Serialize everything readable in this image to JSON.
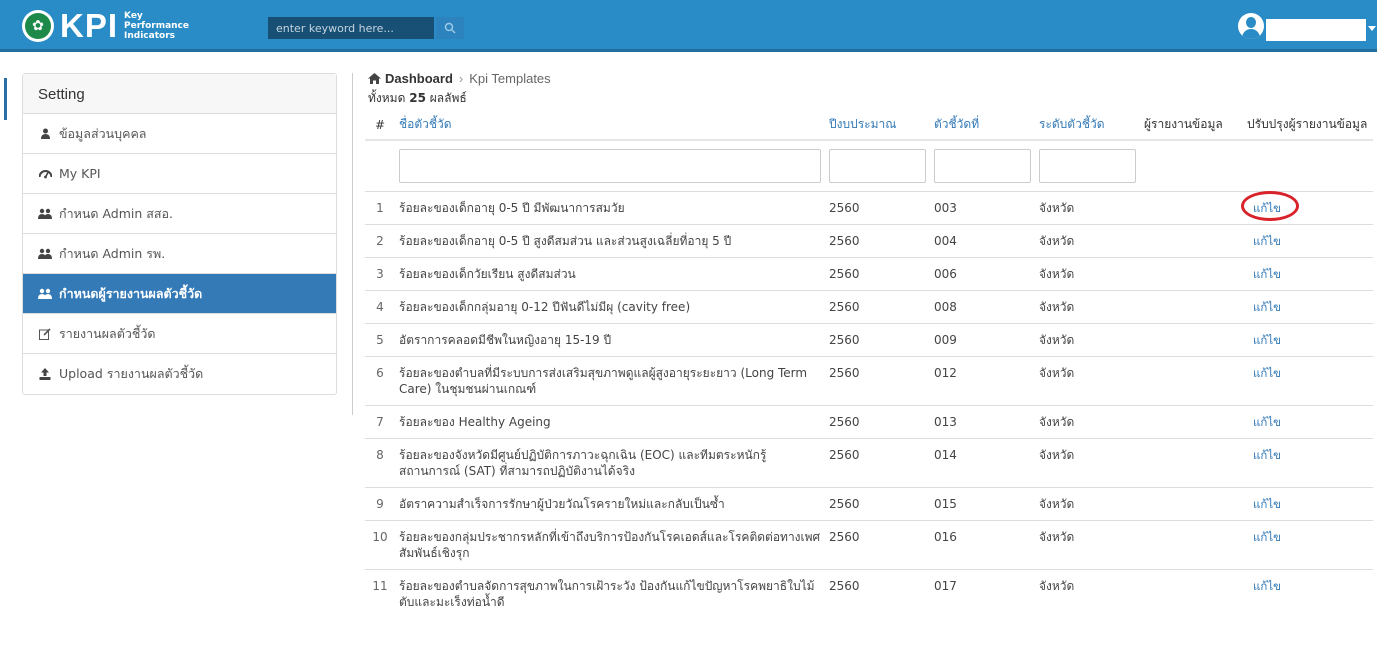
{
  "header": {
    "logo_text": "KPI",
    "logo_subtitle": "Key Performance Indicators",
    "search_placeholder": "enter keyword here..."
  },
  "sidebar": {
    "title": "Setting",
    "items": [
      {
        "label": "ข้อมูลส่วนบุคคล",
        "icon": "user-icon"
      },
      {
        "label": "My KPI",
        "icon": "dashboard-icon"
      },
      {
        "label": "กำหนด Admin สสอ.",
        "icon": "users-icon"
      },
      {
        "label": "กำหนด Admin รพ.",
        "icon": "users-icon"
      },
      {
        "label": "กำหนดผู้รายงานผลตัวชี้วัด",
        "icon": "users-icon",
        "active": true
      },
      {
        "label": "รายงานผลตัวชี้วัด",
        "icon": "edit-icon"
      },
      {
        "label": "Upload รายงานผลตัวชี้วัด",
        "icon": "upload-icon"
      }
    ]
  },
  "breadcrumb": {
    "home": "Dashboard",
    "separator": "›",
    "current": "Kpi Templates"
  },
  "summary": {
    "prefix": "ทั้งหมด",
    "count": "25",
    "suffix": "ผลลัพธ์"
  },
  "table": {
    "headers": {
      "num": "#",
      "name": "ชื่อตัวชี้วัด",
      "year": "ปีงบประมาณ",
      "code": "ตัวชี้วัดที่",
      "level": "ระดับตัวชี้วัด",
      "reporter": "ผู้รายงานข้อมูล",
      "update": "ปรับปรุงผู้รายงานข้อมูล"
    },
    "rows": [
      {
        "num": "1",
        "name": "ร้อยละของเด็กอายุ 0-5 ปี มีพัฒนาการสมวัย",
        "year": "2560",
        "code": "003",
        "level": "จังหวัด",
        "action": "แก้ไข",
        "highlighted": true
      },
      {
        "num": "2",
        "name": "ร้อยละของเด็กอายุ 0-5 ปี สูงดีสมส่วน และส่วนสูงเฉลี่ยที่อายุ 5 ปี",
        "year": "2560",
        "code": "004",
        "level": "จังหวัด",
        "action": "แก้ไข"
      },
      {
        "num": "3",
        "name": "ร้อยละของเด็กวัยเรียน สูงดีสมส่วน",
        "year": "2560",
        "code": "006",
        "level": "จังหวัด",
        "action": "แก้ไข"
      },
      {
        "num": "4",
        "name": "ร้อยละของเด็กกลุ่มอายุ 0-12 ปีฟันดีไม่มีผุ (cavity free)",
        "year": "2560",
        "code": "008",
        "level": "จังหวัด",
        "action": "แก้ไข"
      },
      {
        "num": "5",
        "name": "อัตราการคลอดมีชีพในหญิงอายุ 15-19 ปี",
        "year": "2560",
        "code": "009",
        "level": "จังหวัด",
        "action": "แก้ไข"
      },
      {
        "num": "6",
        "name": "ร้อยละของตำบลที่มีระบบการส่งเสริมสุขภาพดูแลผู้สูงอายุระยะยาว (Long Term Care) ในชุมชนผ่านเกณฑ์",
        "year": "2560",
        "code": "012",
        "level": "จังหวัด",
        "action": "แก้ไข"
      },
      {
        "num": "7",
        "name": "ร้อยละของ Healthy Ageing",
        "year": "2560",
        "code": "013",
        "level": "จังหวัด",
        "action": "แก้ไข"
      },
      {
        "num": "8",
        "name": "ร้อยละของจังหวัดมีศูนย์ปฏิบัติการภาวะฉุกเฉิน (EOC) และทีมตระหนักรู้สถานการณ์ (SAT) ที่สามารถปฏิบัติงานได้จริง",
        "year": "2560",
        "code": "014",
        "level": "จังหวัด",
        "action": "แก้ไข"
      },
      {
        "num": "9",
        "name": "อัตราความสำเร็จการรักษาผู้ป่วยวัณโรครายใหม่และกลับเป็นซ้ำ",
        "year": "2560",
        "code": "015",
        "level": "จังหวัด",
        "action": "แก้ไข"
      },
      {
        "num": "10",
        "name": "ร้อยละของกลุ่มประชากรหลักที่เข้าถึงบริการป้องกันโรคเอดส์และโรคติดต่อทางเพศสัมพันธ์เชิงรุก",
        "year": "2560",
        "code": "016",
        "level": "จังหวัด",
        "action": "แก้ไข"
      },
      {
        "num": "11",
        "name": "ร้อยละของตำบลจัดการสุขภาพในการเฝ้าระวัง ป้องกันแก้ไขปัญหาโรคพยาธิใบไม้ตับและมะเร็งท่อน้ำดี",
        "year": "2560",
        "code": "017",
        "level": "จังหวัด",
        "action": "แก้ไข"
      }
    ]
  },
  "colors": {
    "topbar": "#2a8cc6",
    "active_item": "#337ab7",
    "link": "#337ab7",
    "highlight_circle": "#d9232b"
  }
}
